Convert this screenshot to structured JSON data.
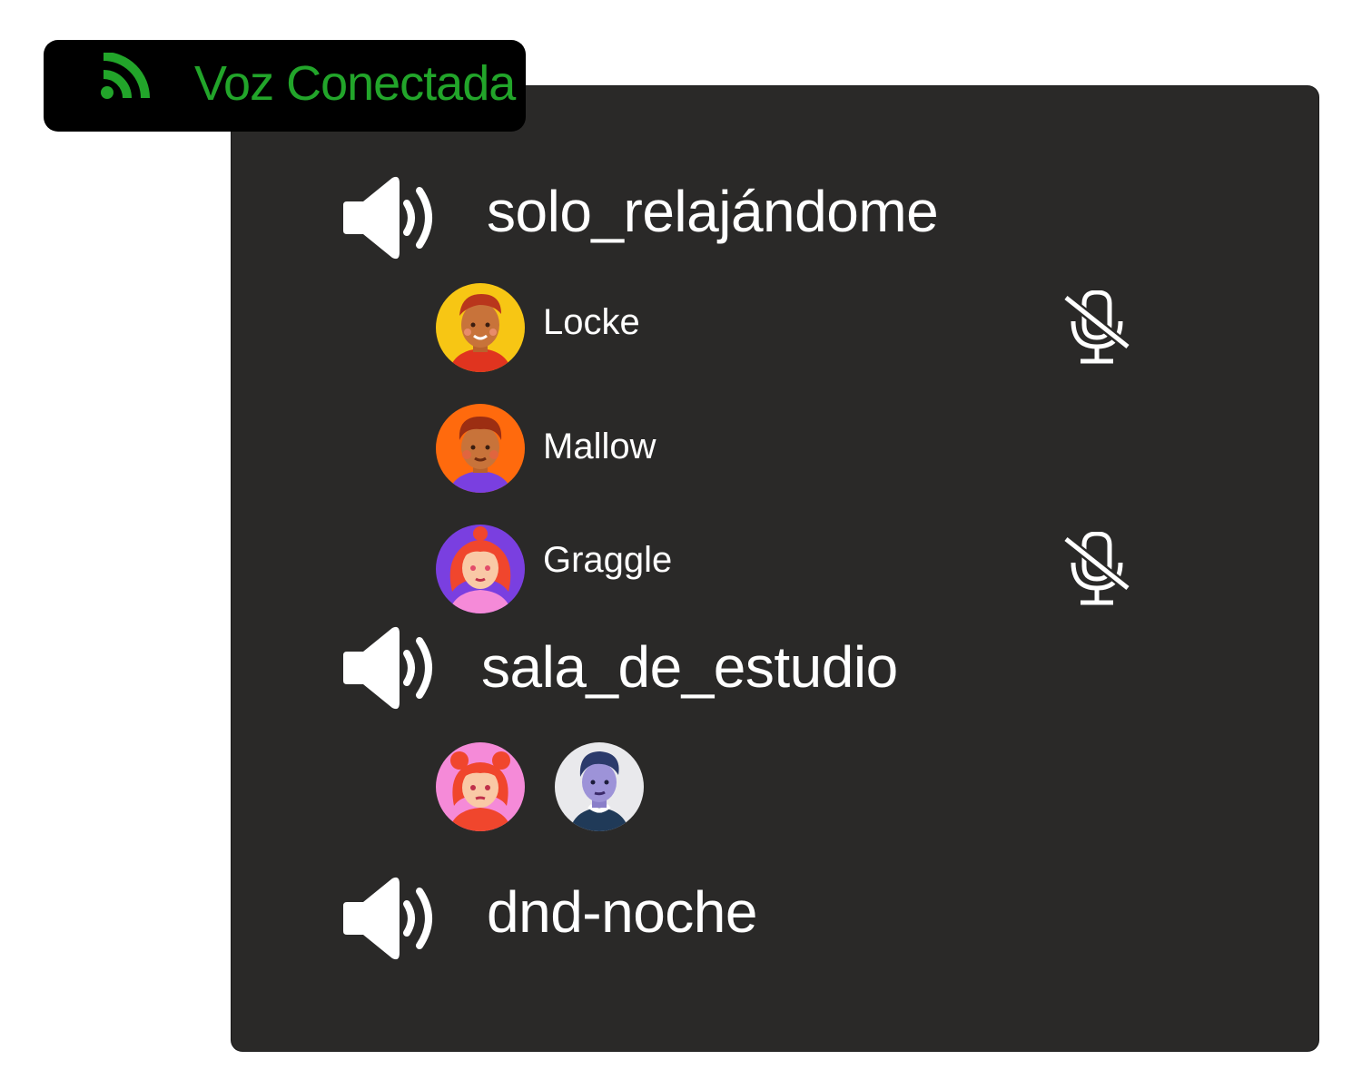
{
  "status": {
    "label": "Voz Conectada",
    "icon": "wifi-signal-icon",
    "color": "#22a52a"
  },
  "channels": [
    {
      "name": "solo_relajándome",
      "icon": "speaker-icon",
      "members": [
        {
          "name": "Locke",
          "muted": true,
          "avatar": "avatar-locke"
        },
        {
          "name": "Mallow",
          "muted": false,
          "avatar": "avatar-mallow"
        },
        {
          "name": "Graggle",
          "muted": true,
          "avatar": "avatar-graggle"
        }
      ]
    },
    {
      "name": "sala_de_estudio",
      "icon": "speaker-icon",
      "members": [
        {
          "avatar": "avatar-girl-pink"
        },
        {
          "avatar": "avatar-boy-blue"
        }
      ]
    },
    {
      "name": "dnd-noche",
      "icon": "speaker-icon",
      "members": []
    }
  ],
  "colors": {
    "panel": "#2a2928",
    "badge": "#000000",
    "text": "#ffffff"
  }
}
